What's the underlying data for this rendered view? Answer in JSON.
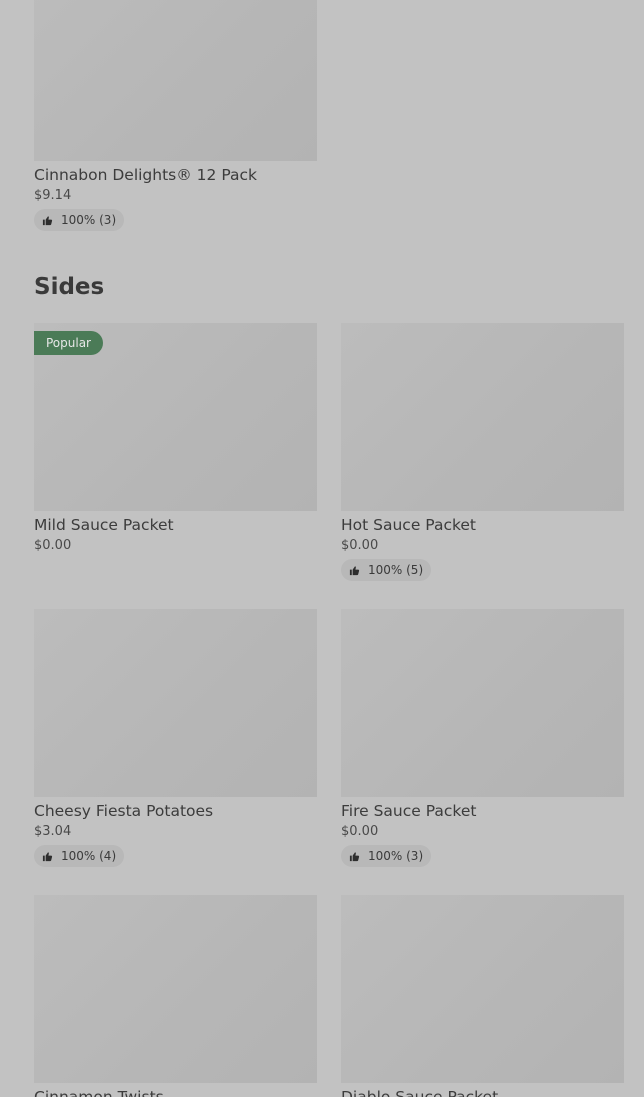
{
  "top_item": {
    "name": "Cinnabon Delights® 12 Pack",
    "price": "$9.14",
    "rating": "100% (3)"
  },
  "section": {
    "title": "Sides"
  },
  "items": [
    {
      "name": "Mild Sauce Packet",
      "price": "$0.00",
      "badge": "Popular"
    },
    {
      "name": "Hot Sauce Packet",
      "price": "$0.00",
      "rating": "100% (5)"
    },
    {
      "name": "Cheesy Fiesta Potatoes",
      "price": "$3.04",
      "rating": "100% (4)"
    },
    {
      "name": "Fire Sauce Packet",
      "price": "$0.00",
      "rating": "100% (3)"
    },
    {
      "name": "Cinnamon Twists"
    },
    {
      "name": "Diablo Sauce Packet"
    }
  ],
  "icons": {
    "rating": "thumbs-up-icon"
  },
  "colors": {
    "background": "#c2c2c2",
    "badge": "#4b7b57"
  }
}
